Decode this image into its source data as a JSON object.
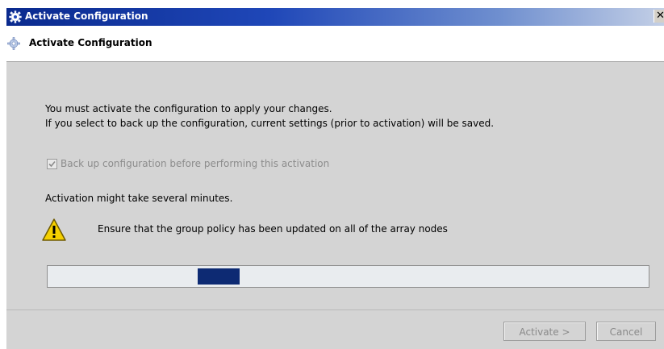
{
  "window": {
    "title": "Activate Configuration",
    "close_glyph": "✕",
    "icon": "gear-icon"
  },
  "header": {
    "title": "Activate Configuration",
    "icon": "gear-icon"
  },
  "body": {
    "message_line1": "You must activate the configuration to apply your changes.",
    "message_line2": "If you select to back up the configuration, current settings (prior to activation) will be saved.",
    "backup_checkbox": {
      "label": "Back up configuration before performing this activation",
      "checked": true,
      "disabled": true
    },
    "note": "Activation might take several minutes.",
    "warning": {
      "icon": "warning-icon",
      "text": "Ensure that the group policy has been updated on all of the array nodes"
    },
    "progress": {
      "indeterminate": true,
      "segment_start": 0.25,
      "segment_fraction": 0.07,
      "color": "#0d2a73"
    }
  },
  "footer": {
    "activate_label": "Activate >",
    "cancel_label": "Cancel"
  }
}
